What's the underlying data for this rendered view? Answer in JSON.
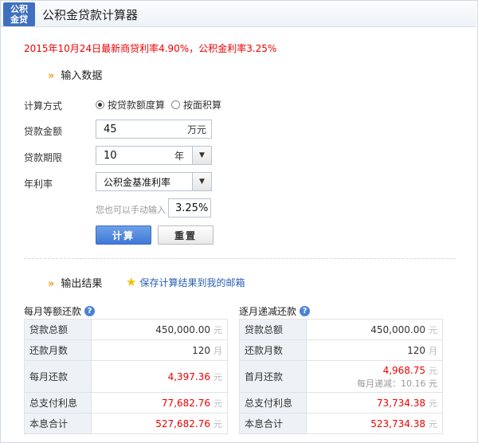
{
  "header": {
    "logo_line1": "公积",
    "logo_line2": "金贷",
    "title": "公积金贷款计算器"
  },
  "notice": "2015年10月24日最新商贷利率4.90%，公积金利率3.25%",
  "input_section": {
    "title": "输入数据",
    "calc_method_label": "计算方式",
    "method_options": [
      {
        "label": "按贷款额度算",
        "checked": true
      },
      {
        "label": "按面积算",
        "checked": false
      }
    ],
    "amount_label": "贷款金额",
    "amount_value": "45",
    "amount_unit": "万元",
    "term_label": "贷款期限",
    "term_value": "10",
    "term_unit": "年",
    "rate_label": "年利率",
    "rate_select": "公积金基准利率",
    "manual_hint": "您也可以手动输入",
    "manual_rate": "3.25%",
    "calc_button": "计算",
    "reset_button": "重置"
  },
  "output_section": {
    "title": "输出结果",
    "save_link": "保存计算结果到我的邮箱",
    "equal_payment": {
      "title": "每月等额还款",
      "rows": [
        {
          "key": "贷款总额",
          "value": "450,000.00",
          "unit": "元"
        },
        {
          "key": "还款月数",
          "value": "120",
          "unit": "月"
        },
        {
          "key": "每月还款",
          "value": "4,397.36",
          "unit": "元"
        },
        {
          "key": "总支付利息",
          "value": "77,682.76",
          "unit": "元"
        },
        {
          "key": "本息合计",
          "value": "527,682.76",
          "unit": "元"
        }
      ]
    },
    "decreasing_payment": {
      "title": "逐月递减还款",
      "rows": [
        {
          "key": "贷款总额",
          "value": "450,000.00",
          "unit": "元"
        },
        {
          "key": "还款月数",
          "value": "120",
          "unit": "月"
        },
        {
          "key": "首月还款",
          "value": "4,968.75",
          "unit": "元",
          "sub": "每月递减：10.16 元"
        },
        {
          "key": "总支付利息",
          "value": "73,734.38",
          "unit": "元"
        },
        {
          "key": "本息合计",
          "value": "523,734.38",
          "unit": "元"
        }
      ]
    }
  },
  "colors": {
    "accent_blue": "#3f78d6",
    "notice_red": "#ee0000",
    "arrow_orange": "#f0a020"
  },
  "icons": {
    "help": "question-circle-icon",
    "star": "star-icon",
    "arrow": "double-chevron-icon"
  }
}
